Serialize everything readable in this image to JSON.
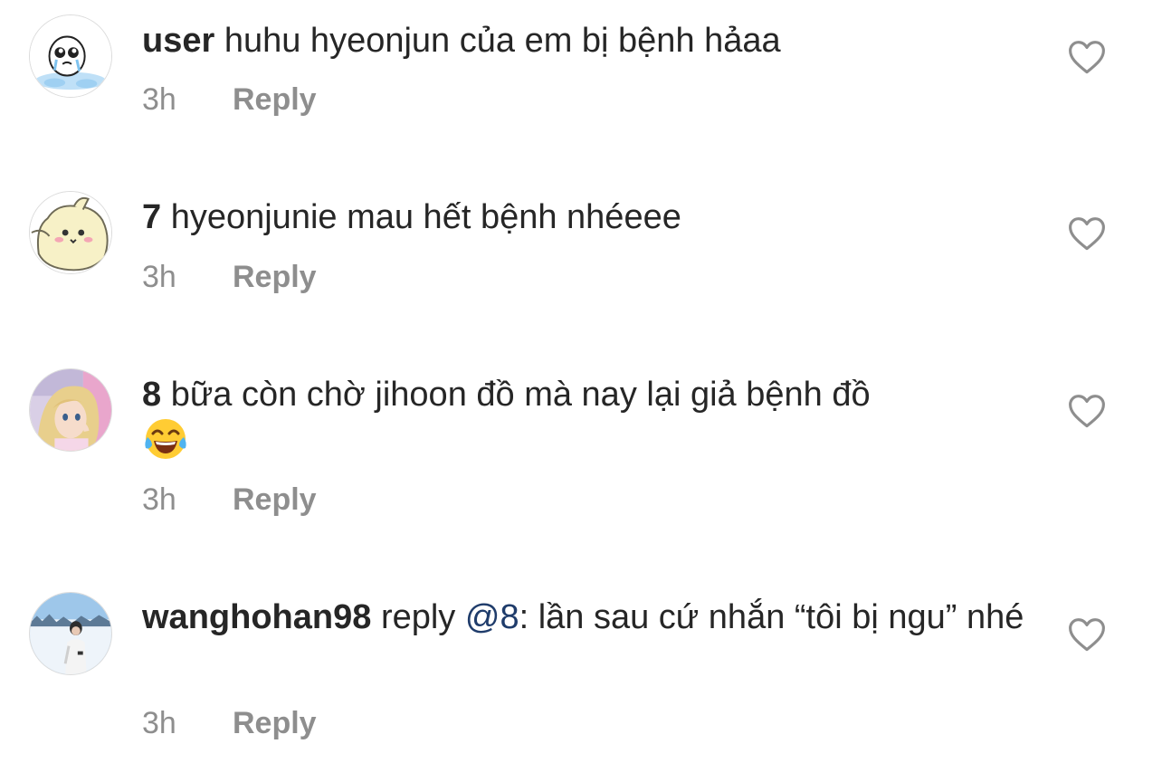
{
  "comments": [
    {
      "username": "user",
      "text": "huhu hyeonjun của em bị bệnh hảaa",
      "time": "3h",
      "reply_label": "Reply",
      "avatar_icon": "crying-cartoon-avatar"
    },
    {
      "username": "7",
      "text": "hyeonjunie mau hết bệnh nhéeee",
      "time": "3h",
      "reply_label": "Reply",
      "avatar_icon": "yellow-chiikawa-avatar"
    },
    {
      "username": "8",
      "text": "bữa còn chờ jihoon đồ mà nay lại giả bệnh đồ",
      "emoji": "face-with-tears-of-joy",
      "time": "3h",
      "reply_label": "Reply",
      "avatar_icon": "anime-girl-avatar"
    },
    {
      "username": "wanghohan98",
      "reply_word": "reply",
      "mention": "@8",
      "text": ": lần sau cứ nhắn “tôi bị ngu” nhé",
      "time": "3h",
      "reply_label": "Reply",
      "avatar_icon": "snow-photo-avatar"
    }
  ],
  "icons": {
    "like": "heart-outline-icon"
  },
  "colors": {
    "text": "#262626",
    "secondary": "#8e8e8e",
    "mention": "#1f3c6b"
  }
}
